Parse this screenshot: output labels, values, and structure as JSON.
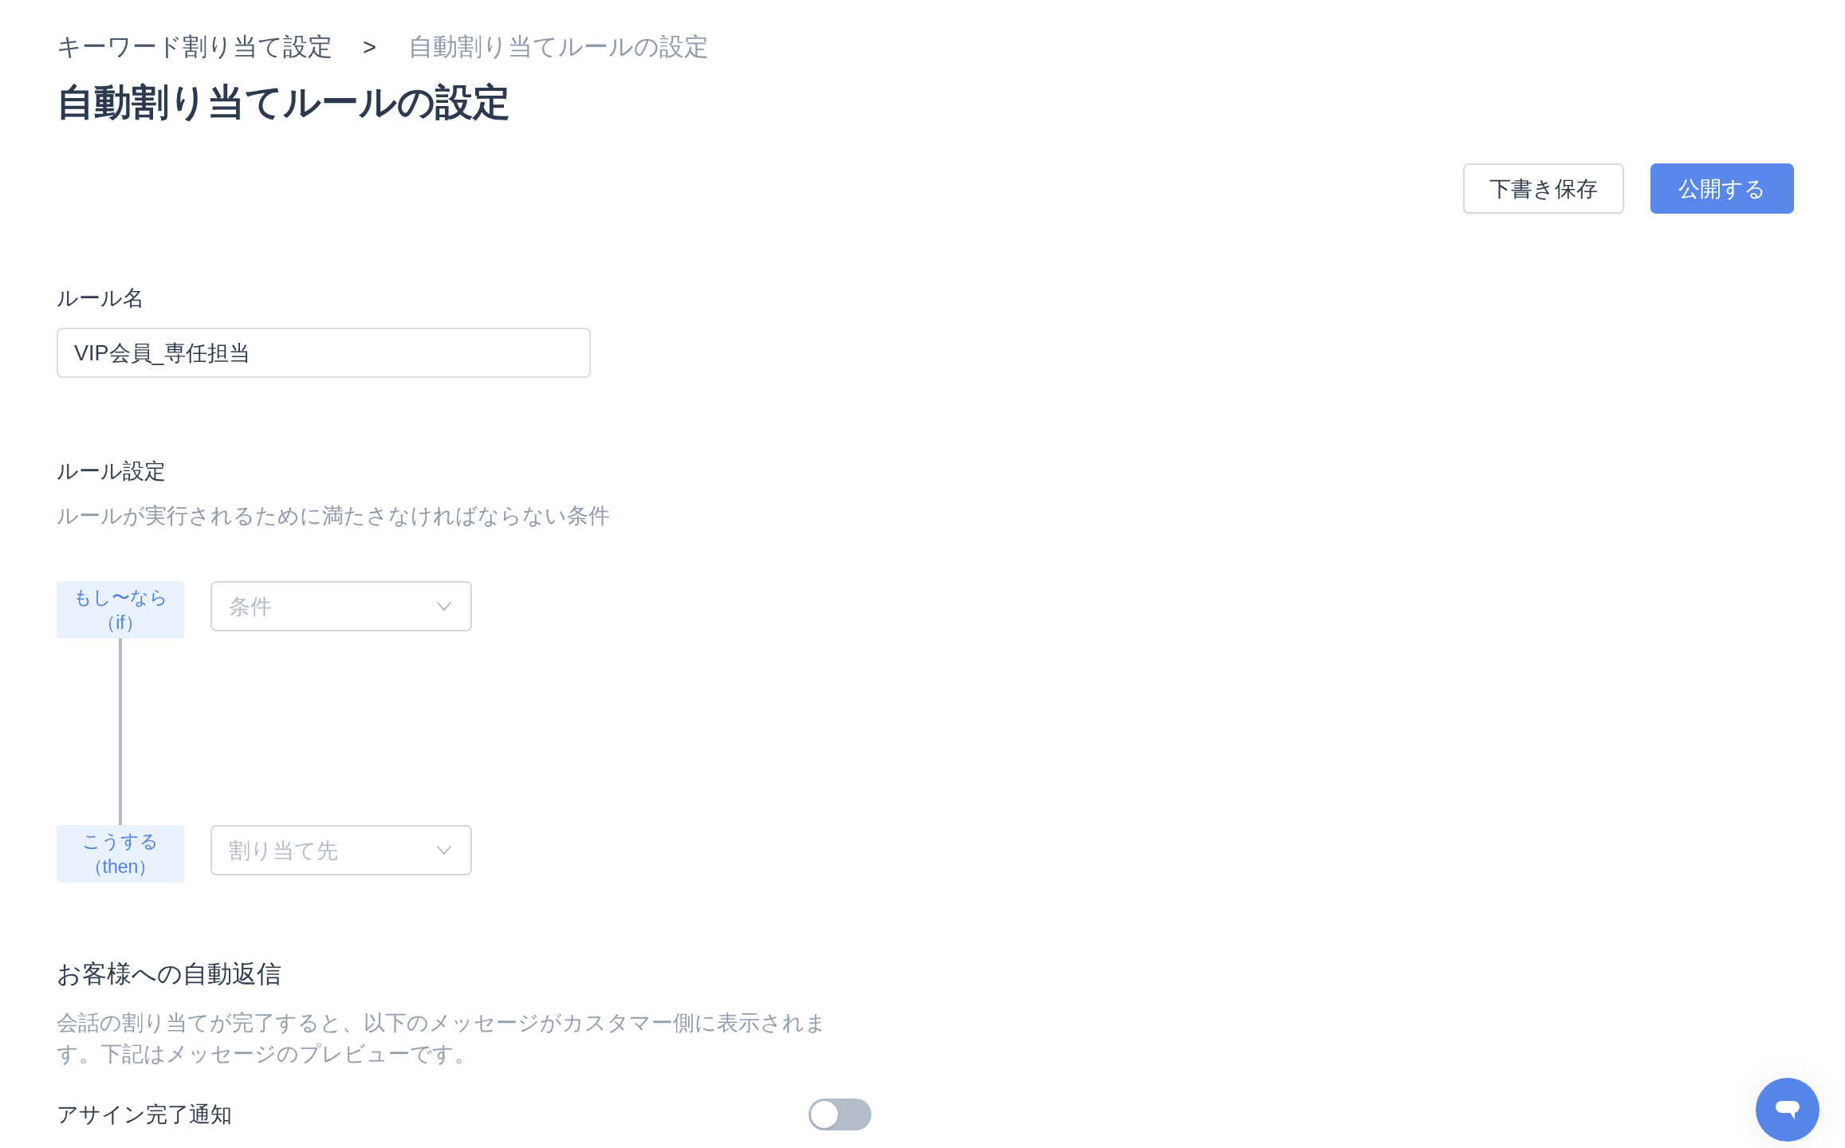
{
  "breadcrumb": [
    {
      "kind": "link",
      "text": "キーワード割り当て設定"
    },
    {
      "kind": "separator",
      "text": ">"
    },
    {
      "kind": "current",
      "text": "自動割り当てルールの設定"
    }
  ],
  "title": "自動割り当てルールの設定",
  "actions": [
    {
      "kind": "secondary",
      "label": "下書き保存"
    },
    {
      "kind": "primary",
      "label": "公開する"
    }
  ],
  "rule_name": {
    "label": "ルール名",
    "value": "VIP会員_専任担当"
  },
  "rule_settings": {
    "label": "ルール設定",
    "description": "ルールが実行されるために満たさなければならない条件",
    "steps": [
      {
        "tag": "もし〜なら（if）",
        "placeholder": "条件"
      },
      {
        "tag": "こうする（then）",
        "placeholder": "割り当て先"
      }
    ]
  },
  "auto_reply": {
    "heading": "お客様への自動返信",
    "description": "会話の割り当てが完了すると、以下のメッセージがカスタマー側に表示されます。下記はメッセージのプレビューです。",
    "toggles": [
      {
        "label": "アサイン完了通知",
        "on": false
      }
    ]
  }
}
